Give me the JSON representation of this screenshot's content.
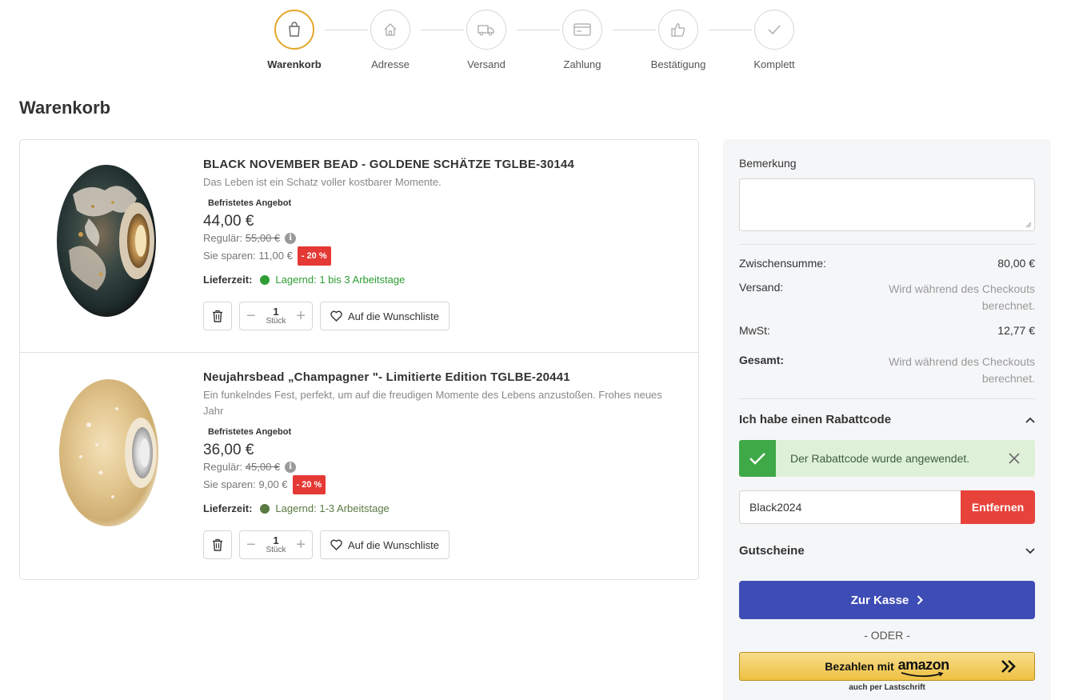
{
  "stepper": {
    "steps": [
      {
        "label": "Warenkorb",
        "icon": "shopping-bag-icon",
        "active": true
      },
      {
        "label": "Adresse",
        "icon": "home-icon",
        "active": false
      },
      {
        "label": "Versand",
        "icon": "truck-icon",
        "active": false
      },
      {
        "label": "Zahlung",
        "icon": "credit-card-icon",
        "active": false
      },
      {
        "label": "Bestätigung",
        "icon": "thumbs-up-icon",
        "active": false
      },
      {
        "label": "Komplett",
        "icon": "checkmark-icon",
        "active": false
      }
    ],
    "active_color": "#e3a72a"
  },
  "page": {
    "title": "Warenkorb"
  },
  "cart": {
    "items": [
      {
        "title": "BLACK NOVEMBER BEAD - GOLDENE SCHÄTZE TGLBE-30144",
        "description": "Das Leben ist ein Schatz voller kostbarer Momente.",
        "offer_label": "Befristetes Angebot",
        "price": "44,00 €",
        "regular_label": "Regulär:",
        "regular_price": "55,00 €",
        "savings_label": "Sie sparen:",
        "savings_value": "11,00 €",
        "discount_badge": "- 20 %",
        "delivery_label": "Lieferzeit:",
        "delivery_status": "Lagernd: 1 bis 3 Arbeitstage",
        "delivery_color": "#2e9e34",
        "quantity": "1",
        "quantity_unit": "Stück",
        "wishlist_label": "Auf die Wunschliste"
      },
      {
        "title": "Neujahrsbead „Champagner \"- Limitierte Edition TGLBE-20441",
        "description": "Ein funkelndes Fest, perfekt, um auf die freudigen Momente des Lebens anzustoßen. Frohes neues Jahr",
        "offer_label": "Befristetes Angebot",
        "price": "36,00 €",
        "regular_label": "Regulär:",
        "regular_price": "45,00 €",
        "savings_label": "Sie sparen:",
        "savings_value": "9,00 €",
        "discount_badge": "- 20 %",
        "delivery_label": "Lieferzeit:",
        "delivery_status": "Lagernd: 1-3 Arbeitstage",
        "delivery_color": "#5a7a43",
        "quantity": "1",
        "quantity_unit": "Stück",
        "wishlist_label": "Auf die Wunschliste"
      }
    ]
  },
  "sidebar": {
    "remark_label": "Bemerkung",
    "subtotal_label": "Zwischensumme:",
    "subtotal_value": "80,00 €",
    "shipping_label": "Versand:",
    "shipping_value_line1": "Wird während des Checkouts",
    "shipping_value_line2": "berechnet.",
    "tax_label": "MwSt:",
    "tax_value": "12,77 €",
    "total_label": "Gesamt:",
    "total_value_line1": "Wird während des Checkouts",
    "total_value_line2": "berechnet.",
    "discount_heading": "Ich habe einen Rabattcode",
    "discount_success": "Der Rabattcode wurde angewendet.",
    "coupon_code": "Black2024",
    "remove_label": "Entfernen",
    "vouchers_heading": "Gutscheine",
    "checkout_label": "Zur Kasse",
    "or_label": "- ODER -",
    "amazon_pay_label": "Bezahlen mit",
    "amazon_logo_text": "amazon",
    "amazon_sub_label": "auch per Lastschrift",
    "checkout_color": "#3e4db5",
    "remove_color": "#e8433a",
    "success_color": "#3fa847"
  }
}
